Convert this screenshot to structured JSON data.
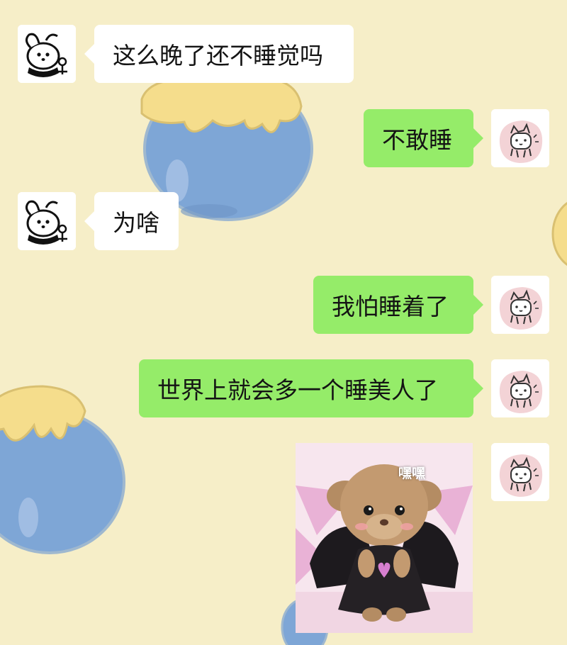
{
  "chat": {
    "messages": [
      {
        "side": "received",
        "text": "这么晚了还不睡觉吗"
      },
      {
        "side": "sent",
        "text": "不敢睡"
      },
      {
        "side": "received",
        "text": "为啥"
      },
      {
        "side": "sent",
        "text": "我怕睡着了"
      },
      {
        "side": "sent",
        "text": "世界上就会多一个睡美人了"
      },
      {
        "side": "sent",
        "type": "sticker",
        "caption": "嘿嘿"
      }
    ]
  },
  "avatars": {
    "contact": "dog-doodle-avatar-icon",
    "self": "cat-doodle-avatar-icon"
  },
  "colors": {
    "background": "#f6eec8",
    "sent_bubble": "#95ec69",
    "received_bubble": "#ffffff",
    "honey_pot": "#7ea6d6",
    "honey": "#f5dd8c"
  }
}
